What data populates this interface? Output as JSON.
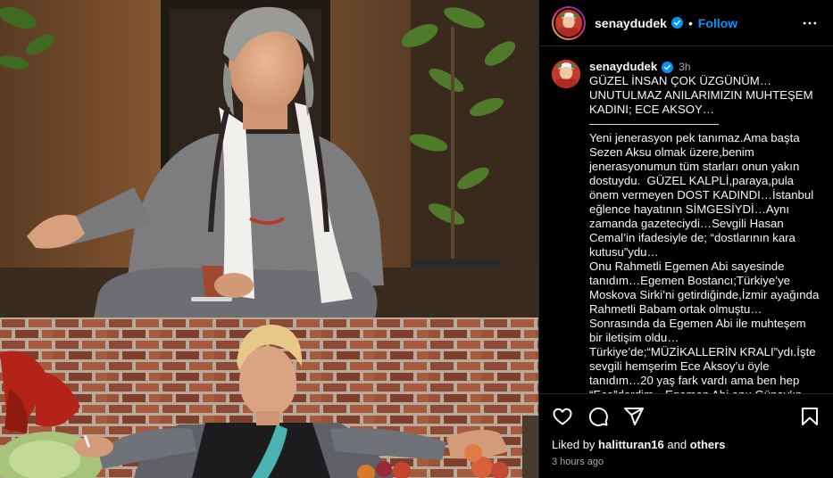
{
  "post": {
    "username": "senaydudek",
    "separator": "•",
    "follow_label": "Follow",
    "caption_time": "3h",
    "caption_text": "GÜZEL İNSAN ÇOK ÜZGÜNÜM…UNUTULMAZ ANILARIMIZIN MUHTEŞEM KADINI; ECE AKSOY…\n———————————\nYeni jenerasyon pek tanımaz.Ama başta  Sezen Aksu olmak üzere,benim jenerasyonumun tüm starları onun yakın dostuydu.  GÜZEL KALPLİ,paraya,pula önem vermeyen DOST KADINDI…İstanbul eğlence hayatının SİMGESİYDİ…Aynı zamanda gazeteciydi…Sevgili Hasan Cemal’in ifadesiyle de; “dostlarının kara kutusu”ydu…\nOnu Rahmetli Egemen Abi sayesinde tanıdım…Egemen Bostancı;Türkiye’ye Moskova Sirki’ni getirdiğinde,İzmir ayağında Rahmetli Babam ortak olmuştu…Sonrasında da Egemen Abi ile muhteşem bir iletişim oldu…Türkiye’de;“MÜZİKALLERİN KRALI”ydı.İşte sevgili hemşerim Ece Aksoy’u öyle tanıdım…20 yaş fark vardı ama ben hep “Ece”derdim…Egemen Abi onu,Günay’ın sahibi Rahmetli Günay Tuncel ile tanıştırmasıyla;Etiler’in girişinde,Stüdyo 54’ün bekleme katında eğlence  yolculuğunu;Ece Bar, Aynalı  Meyhane, Dokuz-Ece Lokantası gibi",
    "likes_prefix": "Liked by",
    "likes_user": "halitturan16",
    "likes_and": "and",
    "likes_others": "others",
    "posted_ago": "3 hours ago"
  },
  "icons": {
    "verified": "verified-badge-icon",
    "more": "more-options-icon",
    "like": "heart-icon",
    "comment": "comment-icon",
    "share": "share-icon",
    "save": "bookmark-icon"
  },
  "colors": {
    "background": "#000000",
    "text": "#f5f5f5",
    "secondary_text": "#a8a8a8",
    "accent_follow": "#0095f6",
    "verified_badge": "#0095f6",
    "divider": "#262626"
  }
}
